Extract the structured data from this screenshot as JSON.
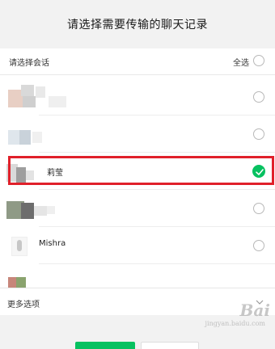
{
  "header": {
    "title": "请选择需要传输的聊天记录"
  },
  "list": {
    "select_label": "请选择会话",
    "select_all_label": "全选",
    "rows": [
      {
        "name": "",
        "checked": false
      },
      {
        "name": "",
        "checked": false
      },
      {
        "name": "莉莹",
        "checked": true
      },
      {
        "name": "",
        "checked": false
      },
      {
        "name": "Mishra",
        "checked": false
      },
      {
        "name": "",
        "checked": false
      }
    ]
  },
  "more_options": {
    "label": "更多选项"
  },
  "watermark": {
    "text": "Bai",
    "sub": "jingyan.baidu.com"
  },
  "colors": {
    "accent": "#07c160",
    "highlight": "#e0202a",
    "background": "#f2f2f2"
  }
}
